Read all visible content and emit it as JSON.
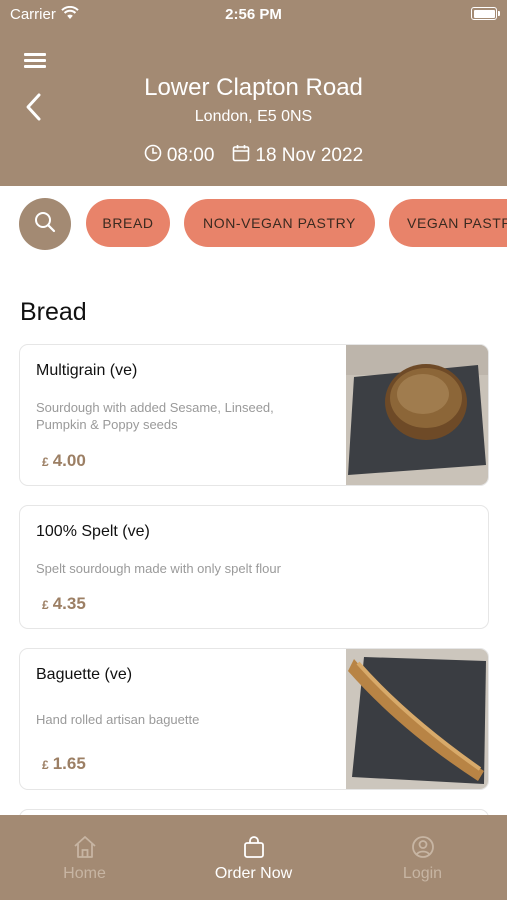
{
  "status_bar": {
    "carrier": "Carrier",
    "time": "2:56 PM"
  },
  "header": {
    "store_name": "Lower Clapton Road",
    "address": "London, E5 0NS",
    "time": "08:00",
    "date": "18 Nov 2022"
  },
  "filters": [
    {
      "label": "BREAD"
    },
    {
      "label": "NON-VEGAN PASTRY"
    },
    {
      "label": "VEGAN PASTRY"
    }
  ],
  "section": {
    "title": "Bread"
  },
  "products": [
    {
      "name": "Multigrain (ve)",
      "description": "Sourdough with added Sesame, Linseed, Pumpkin & Poppy seeds",
      "currency": "£",
      "price": "4.00"
    },
    {
      "name": "100% Spelt (ve)",
      "description": "Spelt sourdough made with only spelt flour",
      "currency": "£",
      "price": "4.35"
    },
    {
      "name": "Baguette (ve)",
      "description": "Hand rolled artisan baguette",
      "currency": "£",
      "price": "1.65"
    }
  ],
  "tabs": [
    {
      "label": "Home",
      "icon": "home-icon",
      "active": false
    },
    {
      "label": "Order Now",
      "icon": "shopping-bag-icon",
      "active": true
    },
    {
      "label": "Login",
      "icon": "user-circle-icon",
      "active": false
    }
  ],
  "colors": {
    "header": "#a38a73",
    "chip": "#e8836a",
    "price": "#9c7f64"
  }
}
